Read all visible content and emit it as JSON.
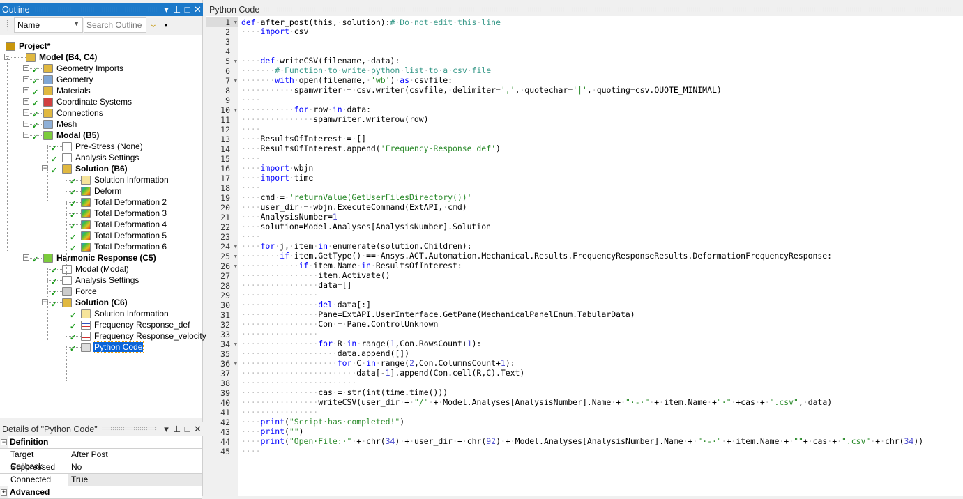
{
  "outline": {
    "title": "Outline",
    "name_select": "Name",
    "search_placeholder": "Search Outline",
    "tree": [
      {
        "label": "Project*",
        "level": 0,
        "bold": true,
        "icon": "project-icon"
      },
      {
        "label": "Model (B4, C4)",
        "level": 1,
        "bold": true,
        "icon": "model-folder-icon",
        "expander": "-"
      },
      {
        "label": "Geometry Imports",
        "level": 2,
        "icon": "geometry-imports-icon",
        "expander": "+",
        "check": true
      },
      {
        "label": "Geometry",
        "level": 2,
        "icon": "geometry-icon",
        "expander": "+",
        "check": true
      },
      {
        "label": "Materials",
        "level": 2,
        "icon": "materials-icon",
        "expander": "+",
        "check": true
      },
      {
        "label": "Coordinate Systems",
        "level": 2,
        "icon": "coordinate-systems-icon",
        "expander": "+",
        "check": true
      },
      {
        "label": "Connections",
        "level": 2,
        "icon": "connections-icon",
        "expander": "+",
        "check": true
      },
      {
        "label": "Mesh",
        "level": 2,
        "icon": "mesh-icon",
        "expander": "+",
        "check": true
      },
      {
        "label": "Modal (B5)",
        "level": 2,
        "bold": true,
        "icon": "modal-icon",
        "expander": "-",
        "check": true
      },
      {
        "label": "Pre-Stress (None)",
        "level": 3,
        "icon": "pre-stress-icon",
        "check": true
      },
      {
        "label": "Analysis Settings",
        "level": 3,
        "icon": "analysis-settings-icon",
        "check": true
      },
      {
        "label": "Solution (B6)",
        "level": 3,
        "bold": true,
        "icon": "solution-icon",
        "expander": "-",
        "check": true
      },
      {
        "label": "Solution Information",
        "level": 4,
        "icon": "solution-information-icon",
        "check": true
      },
      {
        "label": "Deform",
        "level": 4,
        "icon": "deformation-icon",
        "check": true
      },
      {
        "label": "Total Deformation 2",
        "level": 4,
        "icon": "deformation-icon",
        "check": true
      },
      {
        "label": "Total Deformation 3",
        "level": 4,
        "icon": "deformation-icon",
        "check": true
      },
      {
        "label": "Total Deformation 4",
        "level": 4,
        "icon": "deformation-icon",
        "check": true
      },
      {
        "label": "Total Deformation 5",
        "level": 4,
        "icon": "deformation-icon",
        "check": true
      },
      {
        "label": "Total Deformation 6",
        "level": 4,
        "icon": "deformation-icon",
        "check": true
      },
      {
        "label": "Harmonic Response (C5)",
        "level": 2,
        "bold": true,
        "icon": "harmonic-response-icon",
        "expander": "-",
        "check": true
      },
      {
        "label": "Modal (Modal)",
        "level": 3,
        "icon": "pre-stress-icon",
        "check": true
      },
      {
        "label": "Analysis Settings",
        "level": 3,
        "icon": "analysis-settings-icon",
        "check": true
      },
      {
        "label": "Force",
        "level": 3,
        "icon": "force-icon",
        "check": true
      },
      {
        "label": "Solution (C6)",
        "level": 3,
        "bold": true,
        "icon": "solution-icon",
        "expander": "-",
        "check": true
      },
      {
        "label": "Solution Information",
        "level": 4,
        "icon": "solution-information-icon",
        "check": true
      },
      {
        "label": "Frequency Response_def",
        "level": 4,
        "icon": "frequency-response-icon",
        "check": true
      },
      {
        "label": "Frequency Response_velocity",
        "level": 4,
        "icon": "frequency-response-icon",
        "check": true
      },
      {
        "label": "Python Code",
        "level": 4,
        "icon": "python-code-icon",
        "check": true,
        "selected": true
      }
    ]
  },
  "details": {
    "title": "Details of \"Python Code\"",
    "sections": [
      {
        "label": "Definition",
        "expander": "-",
        "rows": [
          {
            "key": "Target Callback",
            "value": "After Post"
          },
          {
            "key": "Suppressed",
            "value": "No"
          },
          {
            "key": "Connected",
            "value": "True",
            "readonly": true
          }
        ]
      },
      {
        "label": "Advanced",
        "expander": "+",
        "rows": []
      }
    ]
  },
  "editor": {
    "title": "Python Code",
    "colors": {
      "keyword": "#0000ff",
      "string": "#2a8a2a",
      "comment": "#3a9a8a",
      "whitespace": "#c0c0c0"
    },
    "folds": [
      1,
      5,
      7,
      10,
      24,
      25,
      26,
      34,
      36
    ],
    "lines": [
      "def after_post(this, solution):# Do not edit this line",
      "    import csv",
      "",
      "",
      "    def writeCSV(filename, data):",
      "       # Function to write python list to a csv file",
      "       with open(filename, 'wb') as csvfile:",
      "           spamwriter = csv.writer(csvfile, delimiter=',', quotechar='|', quoting=csv.QUOTE_MINIMAL)",
      "    ",
      "           for row in data:",
      "               spamwriter.writerow(row)",
      "    ",
      "    ResultsOfInterest = []",
      "    ResultsOfInterest.append('Frequency Response_def')",
      "    ",
      "    import wbjn",
      "    import time",
      "    ",
      "    cmd = 'returnValue(GetUserFilesDirectory())'",
      "    user_dir = wbjn.ExecuteCommand(ExtAPI, cmd)",
      "    AnalysisNumber=1",
      "    solution=Model.Analyses[AnalysisNumber].Solution",
      "    ",
      "    for j, item in enumerate(solution.Children):",
      "        if item.GetType() == Ansys.ACT.Automation.Mechanical.Results.FrequencyResponseResults.DeformationFrequencyResponse:",
      "            if item.Name in ResultsOfInterest:",
      "                item.Activate()",
      "                data=[]",
      "                ",
      "                del data[:]",
      "                Pane=ExtAPI.UserInterface.GetPane(MechanicalPanelEnum.TabularData)",
      "                Con = Pane.ControlUnknown",
      "                ",
      "                for R in range(1,Con.RowsCount+1):",
      "                    data.append([])",
      "                    for C in range(2,Con.ColumnsCount+1):",
      "                        data[-1].append(Con.cell(R,C).Text)",
      "                        ",
      "                cas = str(int(time.time()))",
      "                writeCSV(user_dir + \"/\" + Model.Analyses[AnalysisNumber].Name + \" - \" + item.Name +\" \" +cas + \".csv\", data)",
      "                ",
      "    print(\"Script has completed!\")",
      "    print(\"\")",
      "    print(\"Open File: \" + chr(34) + user_dir + chr(92) + Model.Analyses[AnalysisNumber].Name + \" - \" + item.Name + \"\"+ cas + \".csv\" + chr(34))",
      "    "
    ]
  }
}
